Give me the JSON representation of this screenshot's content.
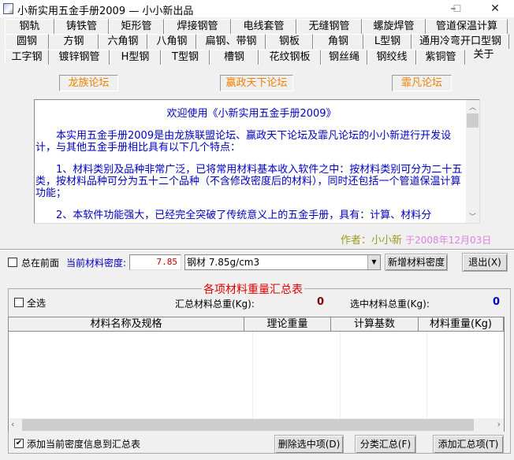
{
  "window": {
    "title": "小新实用五金手册2009 — 小小新出品",
    "minimize": "–",
    "maximize": "☐",
    "close": "✕"
  },
  "tabs": {
    "row1": [
      "钢轨",
      "铸铁管",
      "矩形管",
      "焊接钢管",
      "电线套管",
      "无缝钢管",
      "螺旋焊管",
      "管道保温计算"
    ],
    "row2": [
      "圆钢",
      "方钢",
      "六角钢",
      "八角钢",
      "扁钢、带钢",
      "钢板",
      "角钢",
      "L型钢",
      "通用冷弯开口型钢"
    ],
    "row3": [
      "工字钢",
      "镀锌钢管",
      "H型钢",
      "T型钢",
      "槽钢",
      "花纹钢板",
      "钢丝绳",
      "钢绞线",
      "紫铜管",
      "关于"
    ],
    "selected": "关于"
  },
  "about": {
    "links": [
      "龙族论坛",
      "赢政天下论坛",
      "霏凡论坛"
    ],
    "heading": "欢迎使用《小新实用五金手册2009》",
    "paragraphs": [
      "本实用五金手册2009是由龙族联盟论坛、赢政天下论坛及霏凡论坛的小小新进行开发设计，与其他五金手册相比具有以下几个特点：",
      "1、材料类别及品种非常广泛，已将常用材料基本收入软件之中：按材料类别可分为二十五类，按材料品种可分为五十二个品种（不含修改密度后的材料），同时还包括一个管道保温计算功能；",
      "2、本软件功能强大，已经完全突破了传统意义上的五金手册，具有：计算、材料分"
    ],
    "author": "作者：小小新",
    "date": "于2008年12月03日"
  },
  "controls": {
    "always_on_top": "总在前面",
    "density_label": "当前材料密度:",
    "density_value": "7.85",
    "material_select": "钢材 7.85g/cm3",
    "add_density": "新增材料密度",
    "exit": "退出(X)"
  },
  "summary": {
    "title": "各项材料重量汇总表",
    "select_all": "全选",
    "total_label": "汇总材料总重(Kg):",
    "total_value": "0",
    "selected_label": "选中材料总重(Kg):",
    "selected_value": "0",
    "columns": [
      "材料名称及规格",
      "理论重量",
      "计算基数",
      "材料重量(Kg)"
    ],
    "add_density_info": "添加当前密度信息到汇总表",
    "delete_selected": "删除选中项(D)",
    "categorize": "分类汇总(F)",
    "add_item": "添加汇总项(T)"
  }
}
